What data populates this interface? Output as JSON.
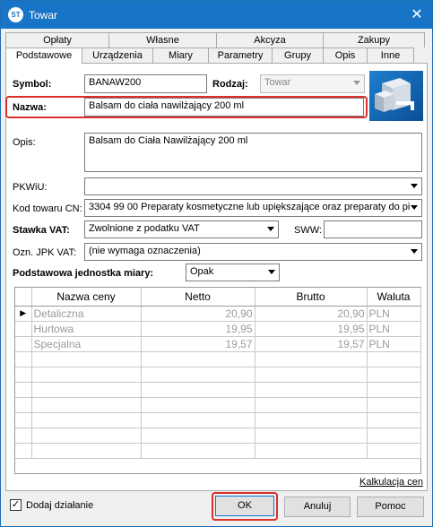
{
  "window": {
    "title": "Towar",
    "app_icon": "ST",
    "close": "✕"
  },
  "tabs": {
    "row1": [
      "Opłaty",
      "Własne",
      "Akcyza",
      "Zakupy"
    ],
    "row2": [
      "Podstawowe",
      "Urządzenia",
      "Miary",
      "Parametry",
      "Grupy",
      "Opis",
      "Inne"
    ],
    "active": "Podstawowe"
  },
  "form": {
    "symbol_label": "Symbol:",
    "symbol_value": "BANAW200",
    "rodzaj_label": "Rodzaj:",
    "rodzaj_value": "Towar",
    "nazwa_label": "Nazwa:",
    "nazwa_value": "Balsam do ciała nawilżający 200 ml",
    "opis_label": "Opis:",
    "opis_value": "Balsam do Ciała Nawilżający 200 ml",
    "pkwiu_label": "PKWiU:",
    "pkwiu_value": "",
    "kod_label": "Kod towaru CN:",
    "kod_value": "3304 99 00 Preparaty kosmetyczne lub upiększające oraz preparaty do pi",
    "vat_label": "Stawka VAT:",
    "vat_value": "Zwolnione z podatku VAT",
    "sww_label": "SWW:",
    "sww_value": "",
    "jpk_label": "Ozn. JPK VAT:",
    "jpk_value": "(nie wymaga oznaczenia)",
    "jm_label": "Podstawowa jednostka miary:",
    "jm_value": "Opak"
  },
  "price_table": {
    "headers": [
      "Nazwa ceny",
      "Netto",
      "Brutto",
      "Waluta"
    ],
    "rows": [
      {
        "name": "Detaliczna",
        "netto": "20,90",
        "brutto": "20,90",
        "waluta": "PLN"
      },
      {
        "name": "Hurtowa",
        "netto": "19,95",
        "brutto": "19,95",
        "waluta": "PLN"
      },
      {
        "name": "Specjalna",
        "netto": "19,57",
        "brutto": "19,57",
        "waluta": "PLN"
      }
    ],
    "current_row_marker": "▶"
  },
  "kalkulacja_link": "Kalkulacja cen",
  "footer": {
    "checkbox_label": "Dodaj działanie",
    "checkbox_checked": "✓",
    "ok": "OK",
    "anuluj": "Anuluj",
    "pomoc": "Pomoc"
  },
  "colors": {
    "titlebar": "#1874c6",
    "highlight": "#d9302c"
  }
}
